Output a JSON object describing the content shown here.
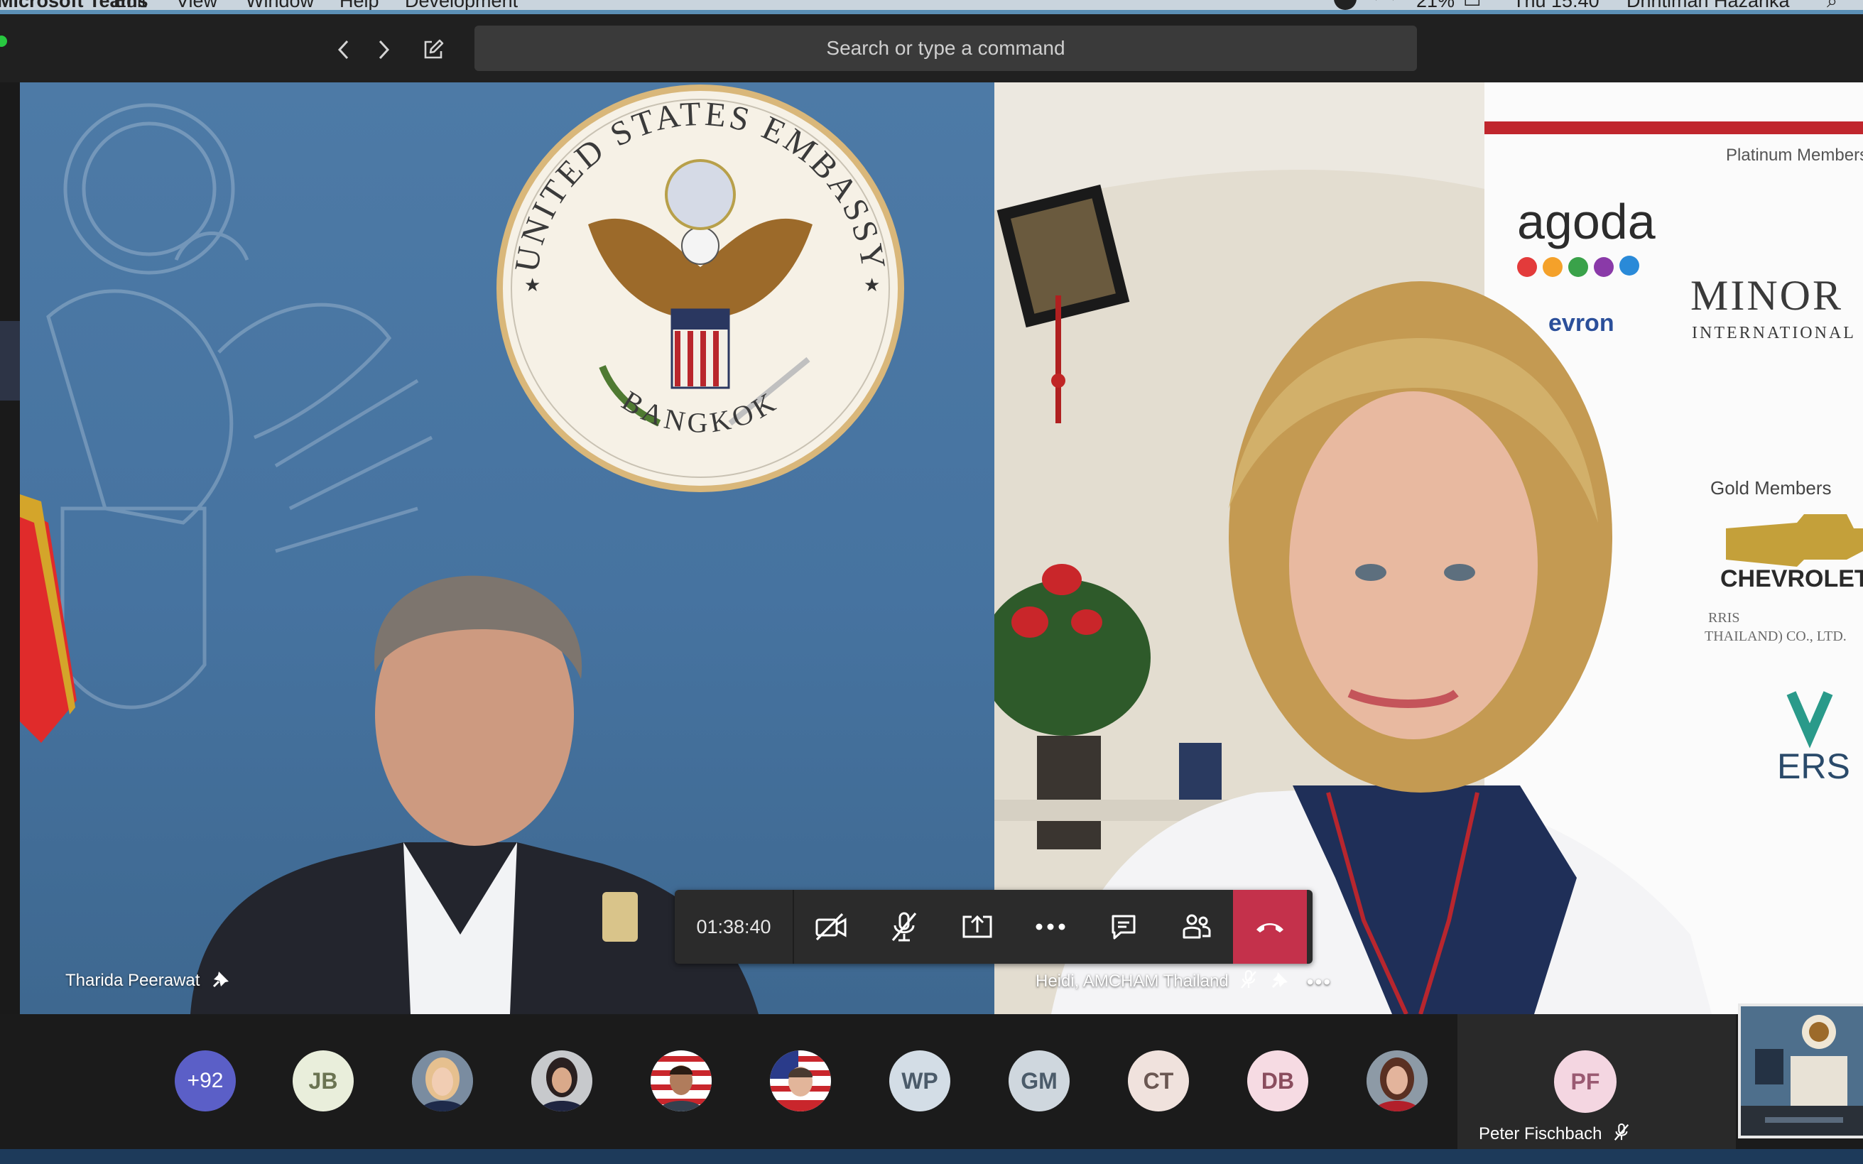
{
  "menubar": {
    "items": [
      "Microsoft Teams",
      "Edit",
      "View",
      "Window",
      "Help",
      "Development"
    ],
    "battery": "21%",
    "clock": "Thu 15:40",
    "user": "Dhritiman Hazarika"
  },
  "titlebar": {
    "search_placeholder": "Search or type a command",
    "back_icon": "chevron-left-icon",
    "forward_icon": "chevron-right-icon",
    "compose_icon": "compose-icon"
  },
  "tiles": {
    "left": {
      "speaker_name": "Tharida Peerawat",
      "seal_top_text": "UNITED STATES EMBASSY",
      "seal_bottom_text": "BANGKOK"
    },
    "right": {
      "speaker_name": "Heidi, AMCHAM Thailand",
      "banner": {
        "platinum": "Platinum Members",
        "agoda": "agoda",
        "chevron_partial": "evron",
        "minor": "MINOR",
        "minor_sub": "INTERNATIONAL",
        "gold": "Gold Members",
        "chevrolet": "CHEVROLET",
        "company_line1": "RRIS",
        "company_line2": "THAILAND) CO., LTD.",
        "v_partial": "ERS"
      }
    }
  },
  "controls": {
    "timer": "01:38:40",
    "icons": [
      "video-off-icon",
      "mic-off-icon",
      "share-screen-icon",
      "more-icon",
      "chat-icon",
      "participants-icon",
      "hang-up-icon"
    ]
  },
  "roster": {
    "overflow_count": "+92",
    "initials": [
      "JB",
      "WP",
      "GM",
      "CT",
      "DB"
    ],
    "featured": {
      "initials": "PF",
      "name": "Peter Fischbach"
    }
  },
  "colors": {
    "hangup": "#c4314b",
    "overflow_avatar": "#5b5fc7",
    "titlebar": "#202020",
    "search": "#3a3a3a"
  }
}
